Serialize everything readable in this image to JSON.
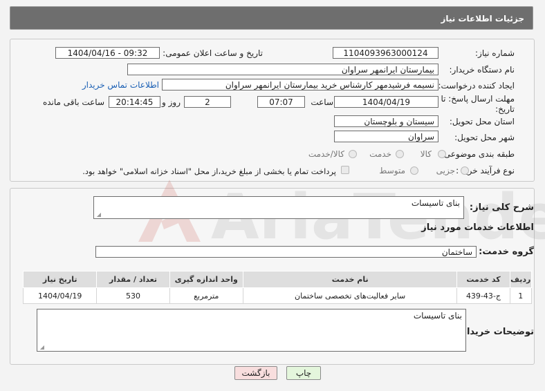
{
  "header": {
    "title": "جزئیات اطلاعات نیاز"
  },
  "fields": {
    "need_number_label": "شماره نیاز:",
    "need_number": "1104093963000124",
    "announce_label": "تاریخ و ساعت اعلان عمومی:",
    "announce_value": "1404/04/16 - 09:32",
    "buyer_org_label": "نام دستگاه خریدار:",
    "buyer_org": "بیمارستان ایرانمهر سراوان",
    "creator_label": "ایجاد کننده درخواست:",
    "creator": "نسیمه فرشیدمهر کارشناس خرید بیمارستان ایرانمهر سراوان",
    "contact_link": "اطلاعات تماس خریدار",
    "deadline_label": "مهلت ارسال پاسخ: تا تاریخ:",
    "deadline_date": "1404/04/19",
    "time_label": "ساعت",
    "deadline_time": "07:07",
    "days_value": "2",
    "days_label": "روز و",
    "remaining_value": "20:14:45",
    "remaining_label": "ساعت باقی مانده",
    "province_label": "استان محل تحویل:",
    "province": "سیستان و بلوچستان",
    "city_label": "شهر محل تحویل:",
    "city": "سراوان",
    "category_label": "طبقه بندی موضوعی:",
    "category_options": [
      "کالا",
      "خدمت",
      "کالا/خدمت"
    ],
    "process_label": "نوع فرآیند خرید :",
    "process_options": [
      "جزیی",
      "متوسط"
    ],
    "payment_text": "پرداخت تمام یا بخشی از مبلغ خرید،از محل \"اسناد خزانه اسلامی\" خواهد بود."
  },
  "summary": {
    "label": "شرح کلی نیاز:",
    "value": "بنای تاسیسات",
    "services_title": "اطلاعات خدمات مورد نیاز",
    "group_label": "گروه خدمت:",
    "group_value": "ساختمان"
  },
  "table": {
    "headers": [
      "ردیف",
      "کد خدمت",
      "نام خدمت",
      "واحد اندازه گیری",
      "تعداد / مقدار",
      "تاریخ نیاز"
    ],
    "rows": [
      [
        "1",
        "ج-43-439",
        "سایر فعالیت‌های تخصصی ساختمان",
        "مترمربع",
        "530",
        "1404/04/19"
      ]
    ]
  },
  "buyer_notes": {
    "label": "توضیحات خریدار:",
    "value": "بنای تاسیسات"
  },
  "buttons": {
    "print": "چاپ",
    "back": "بازگشت"
  },
  "watermark": {
    "text": "AriaTender.neT"
  },
  "colors": {
    "header_bg": "#6e6e6e",
    "link": "#1a5fb4",
    "back_button_bg": "#f8dede",
    "print_button_bg": "#e4f6dc"
  }
}
